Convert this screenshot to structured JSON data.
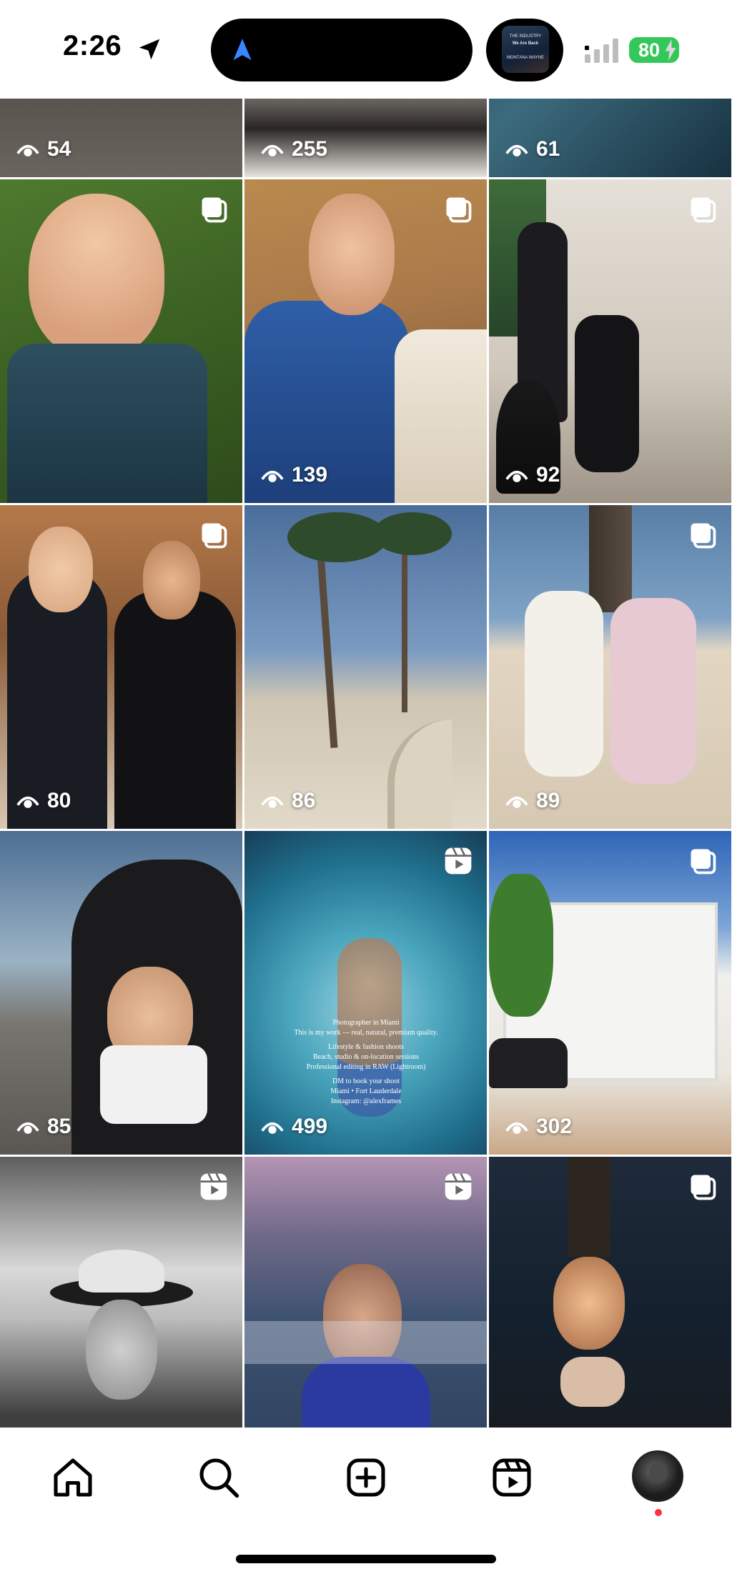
{
  "status_bar": {
    "time": "2:26",
    "battery": "80",
    "now_playing_art_text": [
      "THE INDUSTRY",
      "We Are Back",
      "MONTANA WAYNE"
    ],
    "battery_color": "#34c759"
  },
  "grid": {
    "posts": [
      {
        "views": "54",
        "badge": "none"
      },
      {
        "views": "255",
        "badge": "none"
      },
      {
        "views": "61",
        "badge": "none"
      },
      {
        "views": "",
        "badge": "carousel"
      },
      {
        "views": "139",
        "badge": "carousel"
      },
      {
        "views": "92",
        "badge": "carousel"
      },
      {
        "views": "80",
        "badge": "carousel"
      },
      {
        "views": "86",
        "badge": "none"
      },
      {
        "views": "89",
        "badge": "carousel"
      },
      {
        "views": "85",
        "badge": "none"
      },
      {
        "views": "499",
        "badge": "reel"
      },
      {
        "views": "302",
        "badge": "carousel"
      },
      {
        "views": "",
        "badge": "reel"
      },
      {
        "views": "",
        "badge": "reel"
      },
      {
        "views": "",
        "badge": "carousel"
      }
    ],
    "reel_overlay_text": [
      "Photographer in Miami",
      "This is my work — real, natural, premium quality.",
      "Lifestyle & fashion shoots",
      "Beach, studio & on-location sessions",
      "Professional editing in RAW (Lightroom)",
      "DM to book your shoot",
      "Miami • Fort Lauderdale",
      "Instagram: @alexframes"
    ]
  },
  "bottom_nav": {
    "items": [
      "home-icon",
      "search-icon",
      "create-icon",
      "reels-icon",
      "profile-avatar"
    ],
    "notification_color": "#ff3040"
  }
}
